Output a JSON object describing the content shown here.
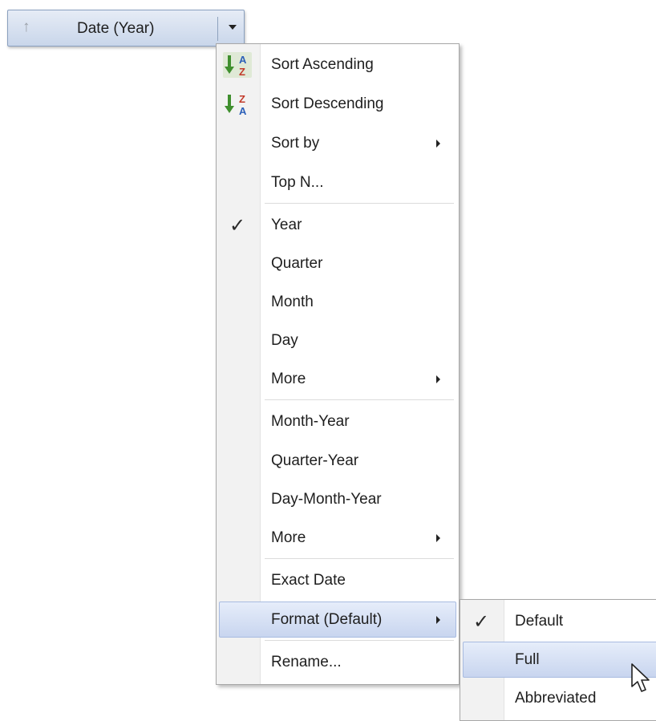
{
  "field_header": {
    "label": "Date (Year)",
    "sort_icon": "sort-up-arrow-icon",
    "dropdown_icon": "chevron-down-icon"
  },
  "main_menu": {
    "items": [
      {
        "label": "Sort Ascending",
        "icon": "sort-ascending-icon"
      },
      {
        "label": "Sort Descending",
        "icon": "sort-descending-icon"
      },
      {
        "label": "Sort by",
        "submenu": true
      },
      {
        "label": "Top N..."
      },
      {
        "label": "Year",
        "checked": true
      },
      {
        "label": "Quarter"
      },
      {
        "label": "Month"
      },
      {
        "label": "Day"
      },
      {
        "label": "More",
        "submenu": true
      },
      {
        "label": "Month-Year"
      },
      {
        "label": "Quarter-Year"
      },
      {
        "label": "Day-Month-Year"
      },
      {
        "label": "More",
        "submenu": true
      },
      {
        "label": "Exact Date"
      },
      {
        "label": "Format (Default)",
        "submenu": true,
        "highlighted": true
      },
      {
        "label": "Rename..."
      }
    ]
  },
  "format_submenu": {
    "items": [
      {
        "label": "Default",
        "checked": true
      },
      {
        "label": "Full",
        "highlighted": true
      },
      {
        "label": "Abbreviated"
      }
    ]
  },
  "colors": {
    "highlight": "#c8d5ef",
    "header": "#c9d6ea"
  }
}
